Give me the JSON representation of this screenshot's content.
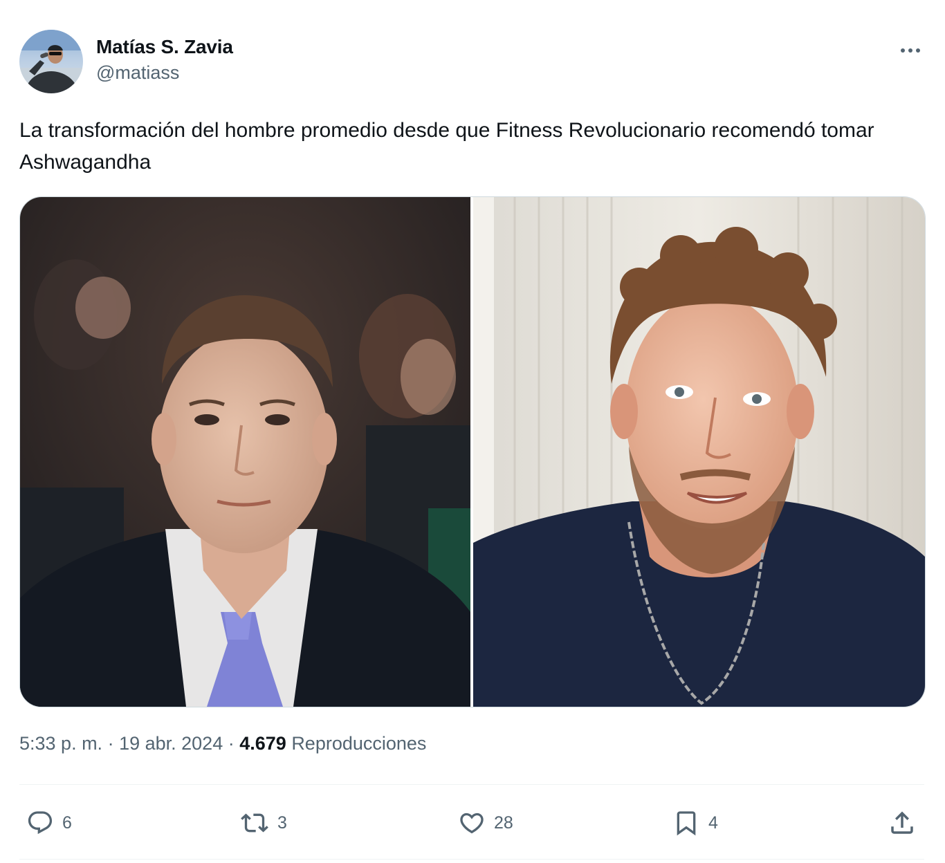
{
  "author": {
    "display_name": "Matías S. Zavia",
    "handle": "@matiass",
    "avatar_icon": "user-avatar"
  },
  "tweet": {
    "text": "La transformación del hombre promedio desde que Fitness Revolucionario recomendó tomar Ashwagandha"
  },
  "media": {
    "image_count": 2,
    "images": [
      {
        "name": "photo-before",
        "icon": "photo-icon"
      },
      {
        "name": "photo-after",
        "icon": "photo-icon"
      }
    ]
  },
  "meta": {
    "time": "5:33 p. m.",
    "separator": " · ",
    "date": "19 abr. 2024",
    "views_count": "4.679",
    "views_label": "Reproducciones"
  },
  "actions": {
    "reply": {
      "icon": "reply-icon",
      "count": "6"
    },
    "retweet": {
      "icon": "retweet-icon",
      "count": "3"
    },
    "like": {
      "icon": "heart-icon",
      "count": "28"
    },
    "bookmark": {
      "icon": "bookmark-icon",
      "count": "4"
    },
    "share": {
      "icon": "share-icon"
    }
  },
  "more_icon": "more-horizontal-icon",
  "colors": {
    "text_primary": "#0f1419",
    "text_secondary": "#536471",
    "border": "#cfd9de",
    "divider": "#eff3f4"
  }
}
